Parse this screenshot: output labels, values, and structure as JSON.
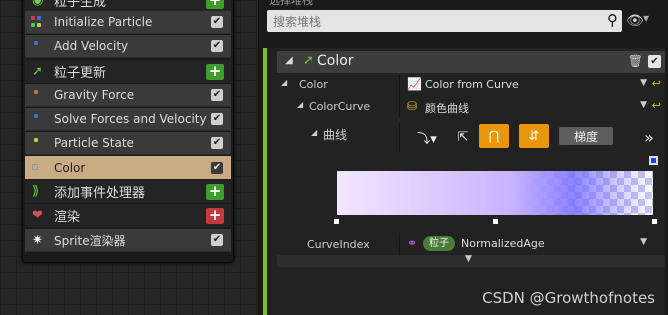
{
  "emitter": {
    "items": [
      {
        "label": "粒子生成",
        "kind": "stage"
      },
      {
        "label": "Initialize Particle",
        "kind": "module"
      },
      {
        "label": "Add Velocity",
        "kind": "module"
      },
      {
        "label": "粒子更新",
        "kind": "stage"
      },
      {
        "label": "Gravity Force",
        "kind": "module"
      },
      {
        "label": "Solve Forces and Velocity",
        "kind": "module"
      },
      {
        "label": "Particle State",
        "kind": "module"
      },
      {
        "label": "Color",
        "kind": "module",
        "selected": true
      },
      {
        "label": "添加事件处理器",
        "kind": "stage"
      },
      {
        "label": "渲染",
        "kind": "stage"
      },
      {
        "label": "Sprite渲染器",
        "kind": "module"
      }
    ]
  },
  "panel": {
    "title": "选择堆栈",
    "search_placeholder": "搜索堆栈",
    "category": {
      "title": "Color",
      "rows": {
        "color": {
          "label": "Color",
          "value": "Color from Curve"
        },
        "colorcurve": {
          "label": "ColorCurve",
          "value": "颜色曲线"
        },
        "curve": {
          "label": "曲线",
          "gradient_button": "梯度"
        },
        "curveindex": {
          "label": "CurveIndex",
          "badge": "粒子",
          "value": "NormalizedAge"
        }
      }
    }
  },
  "watermark": "CSDN @Growthofnotes",
  "colors": {
    "accent_green": "#7bbf2a",
    "selected_row": "#c9ac83",
    "orange_button": "#e8960c",
    "add_green": "#3f9b2b",
    "add_red": "#c43a3a"
  }
}
